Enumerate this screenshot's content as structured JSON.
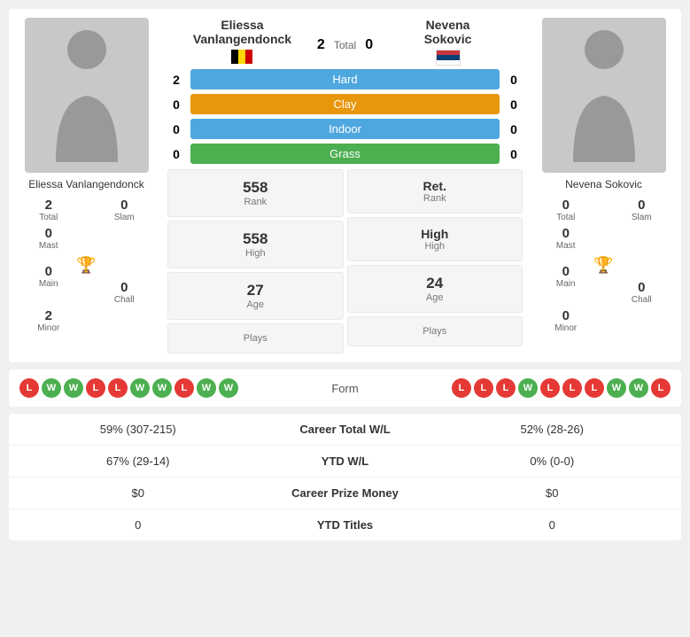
{
  "players": {
    "left": {
      "name": "Eliessa Vanlangendonck",
      "name_line1": "Eliessa",
      "name_line2": "Vanlangendonck",
      "flag": "be",
      "rank": "558",
      "rank_label": "Rank",
      "high": "558",
      "high_label": "High",
      "age": "27",
      "age_label": "Age",
      "plays_label": "Plays",
      "total": "2",
      "total_label": "Total",
      "slam": "0",
      "slam_label": "Slam",
      "mast": "0",
      "mast_label": "Mast",
      "main": "0",
      "main_label": "Main",
      "chall": "0",
      "chall_label": "Chall",
      "minor": "2",
      "minor_label": "Minor"
    },
    "right": {
      "name": "Nevena Sokovic",
      "name_line1": "Nevena",
      "name_line2": "Sokovic",
      "flag": "rs",
      "rank": "Ret.",
      "rank_label": "Rank",
      "high": "High",
      "high_label": "High",
      "age": "24",
      "age_label": "Age",
      "plays_label": "Plays",
      "total": "0",
      "total_label": "Total",
      "slam": "0",
      "slam_label": "Slam",
      "mast": "0",
      "mast_label": "Mast",
      "main": "0",
      "main_label": "Main",
      "chall": "0",
      "chall_label": "Chall",
      "minor": "0",
      "minor_label": "Minor"
    }
  },
  "comparison": {
    "total_label": "Total",
    "left_total": "2",
    "right_total": "0",
    "surfaces": [
      {
        "label": "Hard",
        "left": "2",
        "right": "0",
        "class": "hard"
      },
      {
        "label": "Clay",
        "left": "0",
        "right": "0",
        "class": "clay"
      },
      {
        "label": "Indoor",
        "left": "0",
        "right": "0",
        "class": "indoor"
      },
      {
        "label": "Grass",
        "left": "0",
        "right": "0",
        "class": "grass"
      }
    ]
  },
  "form": {
    "label": "Form",
    "left_form": [
      "L",
      "W",
      "W",
      "L",
      "L",
      "W",
      "W",
      "L",
      "W",
      "W"
    ],
    "right_form": [
      "L",
      "L",
      "L",
      "W",
      "L",
      "L",
      "L",
      "W",
      "W",
      "L"
    ]
  },
  "bottom_stats": [
    {
      "left": "59% (307-215)",
      "center": "Career Total W/L",
      "right": "52% (28-26)"
    },
    {
      "left": "67% (29-14)",
      "center": "YTD W/L",
      "right": "0% (0-0)"
    },
    {
      "left": "$0",
      "center": "Career Prize Money",
      "right": "$0"
    },
    {
      "left": "0",
      "center": "YTD Titles",
      "right": "0"
    }
  ]
}
